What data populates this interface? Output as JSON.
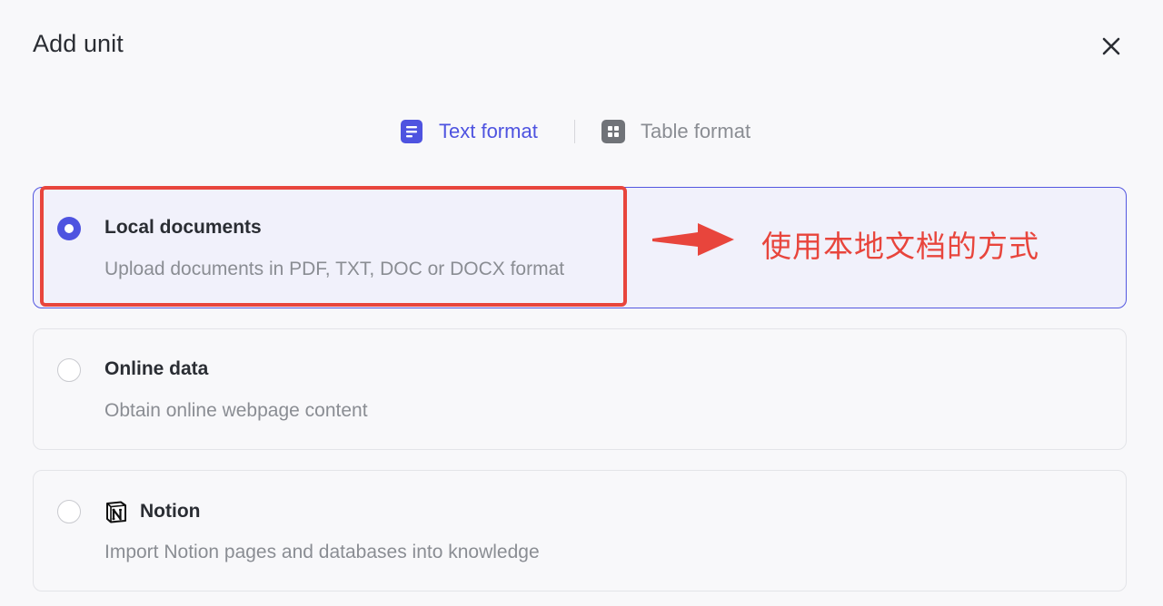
{
  "dialog": {
    "title": "Add unit",
    "close_icon": "close-icon"
  },
  "format_tabs": [
    {
      "label": "Text format",
      "icon": "document-icon",
      "active": true,
      "color": "#4e53e0"
    },
    {
      "label": "Table format",
      "icon": "table-icon",
      "active": false,
      "color": "#8a8d93"
    }
  ],
  "options": [
    {
      "title": "Local documents",
      "description": "Upload documents in PDF, TXT, DOC or DOCX format",
      "selected": true
    },
    {
      "title": "Online data",
      "description": "Obtain online webpage content",
      "selected": false
    },
    {
      "title": "Notion",
      "description": "Import Notion pages and databases into knowledge",
      "icon": "notion-icon",
      "selected": false
    }
  ],
  "annotation": {
    "text": "使用本地文档的方式",
    "color": "#e8453c"
  },
  "colors": {
    "accent": "#4e53e0",
    "annotation": "#e8453c"
  }
}
